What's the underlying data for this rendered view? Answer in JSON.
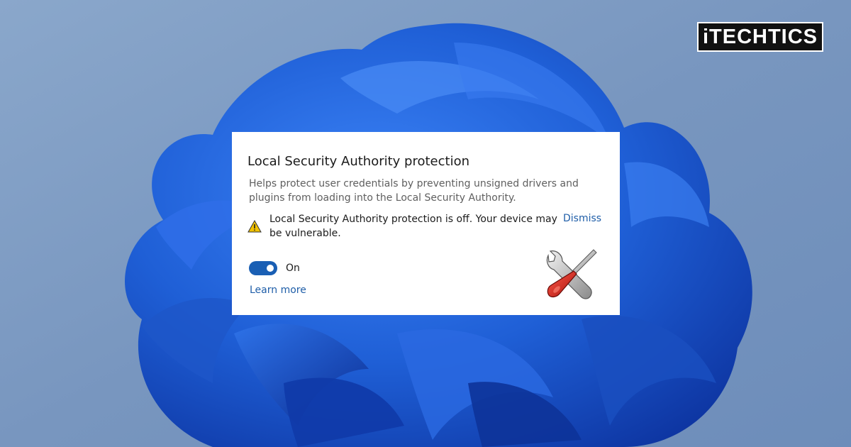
{
  "brand": {
    "logo_text": "iTECHTICS"
  },
  "dialog": {
    "title": "Local Security Authority protection",
    "description": "Helps protect user credentials by preventing unsigned drivers and plugins from loading into the Local Security Authority.",
    "warning": {
      "icon": "warning-icon",
      "text": "Local Security Authority protection is off. Your device may be vulnerable.",
      "dismiss_label": "Dismiss"
    },
    "toggle": {
      "state": true,
      "label": "On"
    },
    "learn_more_label": "Learn more",
    "illustration": "tools-icon"
  },
  "colors": {
    "accent": "#1a5fb4",
    "link": "#1f5ea8",
    "warning": "#f2c200",
    "card_bg": "#ffffff",
    "wallpaper_bg": "#7d9cc3",
    "bloom": "#1f5fd6"
  }
}
